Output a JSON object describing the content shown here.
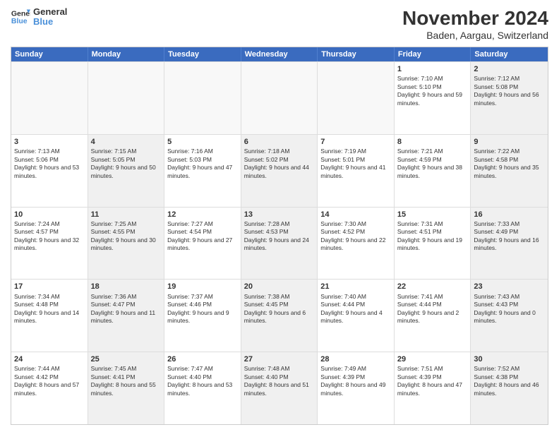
{
  "logo": {
    "line1": "General",
    "line2": "Blue"
  },
  "title": "November 2024",
  "subtitle": "Baden, Aargau, Switzerland",
  "header_days": [
    "Sunday",
    "Monday",
    "Tuesday",
    "Wednesday",
    "Thursday",
    "Friday",
    "Saturday"
  ],
  "rows": [
    [
      {
        "day": "",
        "info": "",
        "shaded": true
      },
      {
        "day": "",
        "info": "",
        "shaded": true
      },
      {
        "day": "",
        "info": "",
        "shaded": true
      },
      {
        "day": "",
        "info": "",
        "shaded": true
      },
      {
        "day": "",
        "info": "",
        "shaded": true
      },
      {
        "day": "1",
        "info": "Sunrise: 7:10 AM\nSunset: 5:10 PM\nDaylight: 9 hours and 59 minutes.",
        "shaded": false
      },
      {
        "day": "2",
        "info": "Sunrise: 7:12 AM\nSunset: 5:08 PM\nDaylight: 9 hours and 56 minutes.",
        "shaded": true
      }
    ],
    [
      {
        "day": "3",
        "info": "Sunrise: 7:13 AM\nSunset: 5:06 PM\nDaylight: 9 hours and 53 minutes.",
        "shaded": false
      },
      {
        "day": "4",
        "info": "Sunrise: 7:15 AM\nSunset: 5:05 PM\nDaylight: 9 hours and 50 minutes.",
        "shaded": true
      },
      {
        "day": "5",
        "info": "Sunrise: 7:16 AM\nSunset: 5:03 PM\nDaylight: 9 hours and 47 minutes.",
        "shaded": false
      },
      {
        "day": "6",
        "info": "Sunrise: 7:18 AM\nSunset: 5:02 PM\nDaylight: 9 hours and 44 minutes.",
        "shaded": true
      },
      {
        "day": "7",
        "info": "Sunrise: 7:19 AM\nSunset: 5:01 PM\nDaylight: 9 hours and 41 minutes.",
        "shaded": false
      },
      {
        "day": "8",
        "info": "Sunrise: 7:21 AM\nSunset: 4:59 PM\nDaylight: 9 hours and 38 minutes.",
        "shaded": false
      },
      {
        "day": "9",
        "info": "Sunrise: 7:22 AM\nSunset: 4:58 PM\nDaylight: 9 hours and 35 minutes.",
        "shaded": true
      }
    ],
    [
      {
        "day": "10",
        "info": "Sunrise: 7:24 AM\nSunset: 4:57 PM\nDaylight: 9 hours and 32 minutes.",
        "shaded": false
      },
      {
        "day": "11",
        "info": "Sunrise: 7:25 AM\nSunset: 4:55 PM\nDaylight: 9 hours and 30 minutes.",
        "shaded": true
      },
      {
        "day": "12",
        "info": "Sunrise: 7:27 AM\nSunset: 4:54 PM\nDaylight: 9 hours and 27 minutes.",
        "shaded": false
      },
      {
        "day": "13",
        "info": "Sunrise: 7:28 AM\nSunset: 4:53 PM\nDaylight: 9 hours and 24 minutes.",
        "shaded": true
      },
      {
        "day": "14",
        "info": "Sunrise: 7:30 AM\nSunset: 4:52 PM\nDaylight: 9 hours and 22 minutes.",
        "shaded": false
      },
      {
        "day": "15",
        "info": "Sunrise: 7:31 AM\nSunset: 4:51 PM\nDaylight: 9 hours and 19 minutes.",
        "shaded": false
      },
      {
        "day": "16",
        "info": "Sunrise: 7:33 AM\nSunset: 4:49 PM\nDaylight: 9 hours and 16 minutes.",
        "shaded": true
      }
    ],
    [
      {
        "day": "17",
        "info": "Sunrise: 7:34 AM\nSunset: 4:48 PM\nDaylight: 9 hours and 14 minutes.",
        "shaded": false
      },
      {
        "day": "18",
        "info": "Sunrise: 7:36 AM\nSunset: 4:47 PM\nDaylight: 9 hours and 11 minutes.",
        "shaded": true
      },
      {
        "day": "19",
        "info": "Sunrise: 7:37 AM\nSunset: 4:46 PM\nDaylight: 9 hours and 9 minutes.",
        "shaded": false
      },
      {
        "day": "20",
        "info": "Sunrise: 7:38 AM\nSunset: 4:45 PM\nDaylight: 9 hours and 6 minutes.",
        "shaded": true
      },
      {
        "day": "21",
        "info": "Sunrise: 7:40 AM\nSunset: 4:44 PM\nDaylight: 9 hours and 4 minutes.",
        "shaded": false
      },
      {
        "day": "22",
        "info": "Sunrise: 7:41 AM\nSunset: 4:44 PM\nDaylight: 9 hours and 2 minutes.",
        "shaded": false
      },
      {
        "day": "23",
        "info": "Sunrise: 7:43 AM\nSunset: 4:43 PM\nDaylight: 9 hours and 0 minutes.",
        "shaded": true
      }
    ],
    [
      {
        "day": "24",
        "info": "Sunrise: 7:44 AM\nSunset: 4:42 PM\nDaylight: 8 hours and 57 minutes.",
        "shaded": false
      },
      {
        "day": "25",
        "info": "Sunrise: 7:45 AM\nSunset: 4:41 PM\nDaylight: 8 hours and 55 minutes.",
        "shaded": true
      },
      {
        "day": "26",
        "info": "Sunrise: 7:47 AM\nSunset: 4:40 PM\nDaylight: 8 hours and 53 minutes.",
        "shaded": false
      },
      {
        "day": "27",
        "info": "Sunrise: 7:48 AM\nSunset: 4:40 PM\nDaylight: 8 hours and 51 minutes.",
        "shaded": true
      },
      {
        "day": "28",
        "info": "Sunrise: 7:49 AM\nSunset: 4:39 PM\nDaylight: 8 hours and 49 minutes.",
        "shaded": false
      },
      {
        "day": "29",
        "info": "Sunrise: 7:51 AM\nSunset: 4:39 PM\nDaylight: 8 hours and 47 minutes.",
        "shaded": false
      },
      {
        "day": "30",
        "info": "Sunrise: 7:52 AM\nSunset: 4:38 PM\nDaylight: 8 hours and 46 minutes.",
        "shaded": true
      }
    ]
  ]
}
